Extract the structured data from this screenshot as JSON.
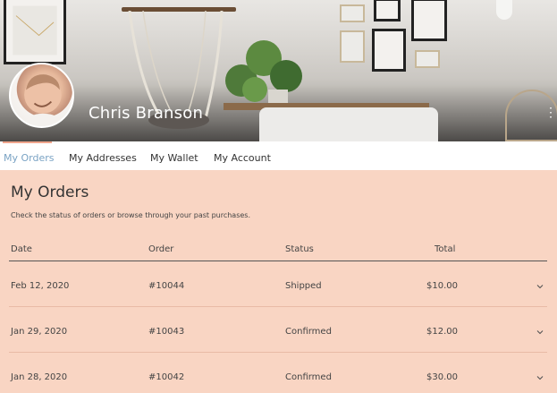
{
  "profile": {
    "name": "Chris Branson"
  },
  "tabs": [
    {
      "label": "My Orders",
      "active": true
    },
    {
      "label": "My Addresses",
      "active": false
    },
    {
      "label": "My Wallet",
      "active": false
    },
    {
      "label": "My Account",
      "active": false
    }
  ],
  "orders": {
    "title": "My Orders",
    "subtitle": "Check the status of orders or browse through your past purchases.",
    "columns": [
      "Date",
      "Order",
      "Status",
      "Total"
    ],
    "rows": [
      {
        "date": "Feb 12, 2020",
        "order": "#10044",
        "status": "Shipped",
        "total": "$10.00"
      },
      {
        "date": "Jan 29, 2020",
        "order": "#10043",
        "status": "Confirmed",
        "total": "$12.00"
      },
      {
        "date": "Jan 28, 2020",
        "order": "#10042",
        "status": "Confirmed",
        "total": "$30.00"
      }
    ]
  },
  "colors": {
    "accent": "#7aa3c4",
    "tab_indicator": "#f0a58c",
    "background": "#f9d5c3"
  },
  "icons": {
    "menu": "more-vertical-icon",
    "expand": "chevron-down-icon"
  }
}
